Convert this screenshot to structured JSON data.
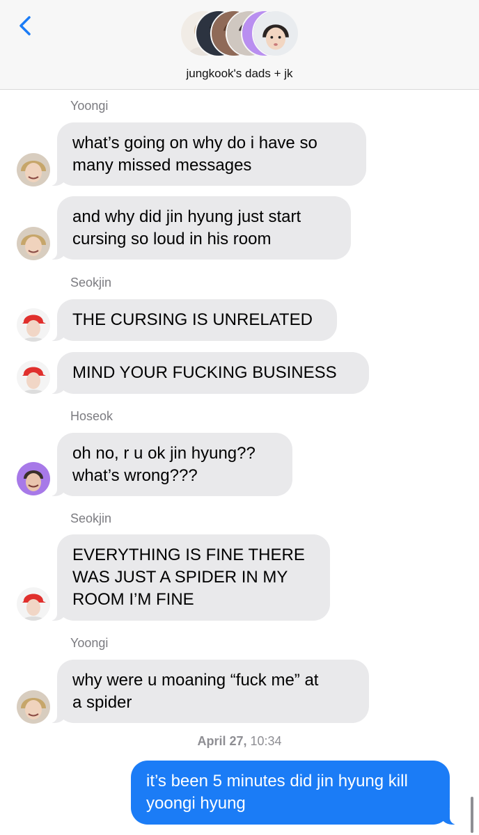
{
  "header": {
    "group_name": "jungkook's dads + jk",
    "accent_color": "#1b7cf6"
  },
  "messages": [
    {
      "sender": "Yoongi",
      "text": "what’s going on why do i have so\nmany missed messages"
    },
    {
      "sender": "",
      "text": "and why did jin hyung just start\ncursing so loud in his room"
    },
    {
      "sender": "Seokjin",
      "text": "THE CURSING IS UNRELATED"
    },
    {
      "sender": "",
      "text": "MIND YOUR FUCKING BUSINESS"
    },
    {
      "sender": "Hoseok",
      "text": "oh no, r u ok jin hyung??\nwhat’s wrong???"
    },
    {
      "sender": "Seokjin",
      "text": "EVERYTHING IS FINE THERE\nWAS JUST A SPIDER IN MY\nROOM I’M FINE"
    },
    {
      "sender": "Yoongi",
      "text": "why were u moaning “fuck me” at\na spider"
    }
  ],
  "timestamp": {
    "date": "April 27,",
    "time": "10:34"
  },
  "sent_message": {
    "text": "it’s been 5 minutes did jin hyung kill\nyoongi hyung"
  },
  "icons": {
    "back": "chevron-left-icon",
    "avatars": [
      "yoongi-avatar",
      "seokjin-avatar",
      "hoseok-avatar"
    ]
  },
  "colors": {
    "received_bubble": "#e9e9eb",
    "sent_bubble": "#1b7cf6",
    "header_bg": "#f7f7f7",
    "meta_text": "#8e8e93"
  }
}
